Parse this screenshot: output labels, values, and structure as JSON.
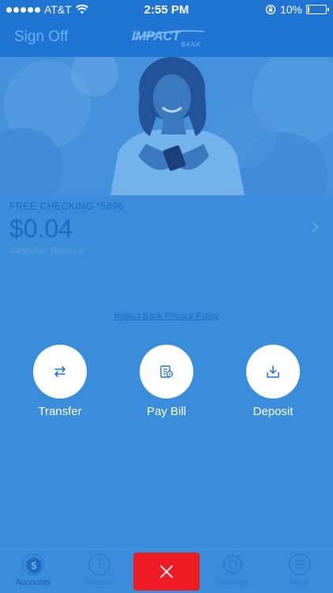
{
  "status_bar": {
    "carrier": "AT&T",
    "time": "2:55 PM",
    "battery": "10%",
    "battery_level": 0.1,
    "icons": [
      "signal-icon",
      "wifi-icon",
      "rotation-lock-icon",
      "battery-icon"
    ]
  },
  "header": {
    "sign_off_label": "Sign Off",
    "logo_text": "IMPACT",
    "logo_subtext": "BANK"
  },
  "account": {
    "name": "FREE CHECKING *5896",
    "balance": "$0.04",
    "balance_label": "Available Balance"
  },
  "privacy_link": "Impact Bank Privacy Policy",
  "actions": [
    {
      "label": "Transfer",
      "icon": "transfer-icon"
    },
    {
      "label": "Pay Bill",
      "icon": "pay-bill-icon"
    },
    {
      "label": "Deposit",
      "icon": "deposit-icon"
    }
  ],
  "tabs": [
    {
      "label": "Accounts",
      "icon": "accounts-icon",
      "active": true
    },
    {
      "label": "Recent",
      "icon": "clock-icon"
    },
    {
      "label": "Settings",
      "icon": "gear-icon"
    },
    {
      "label": "More",
      "icon": "menu-icon"
    }
  ],
  "colors": {
    "background": "#3a8ddb",
    "header": "#1f74d4",
    "accent_red": "#ee1c25",
    "text_dark_blue": "#1d6bc2"
  }
}
